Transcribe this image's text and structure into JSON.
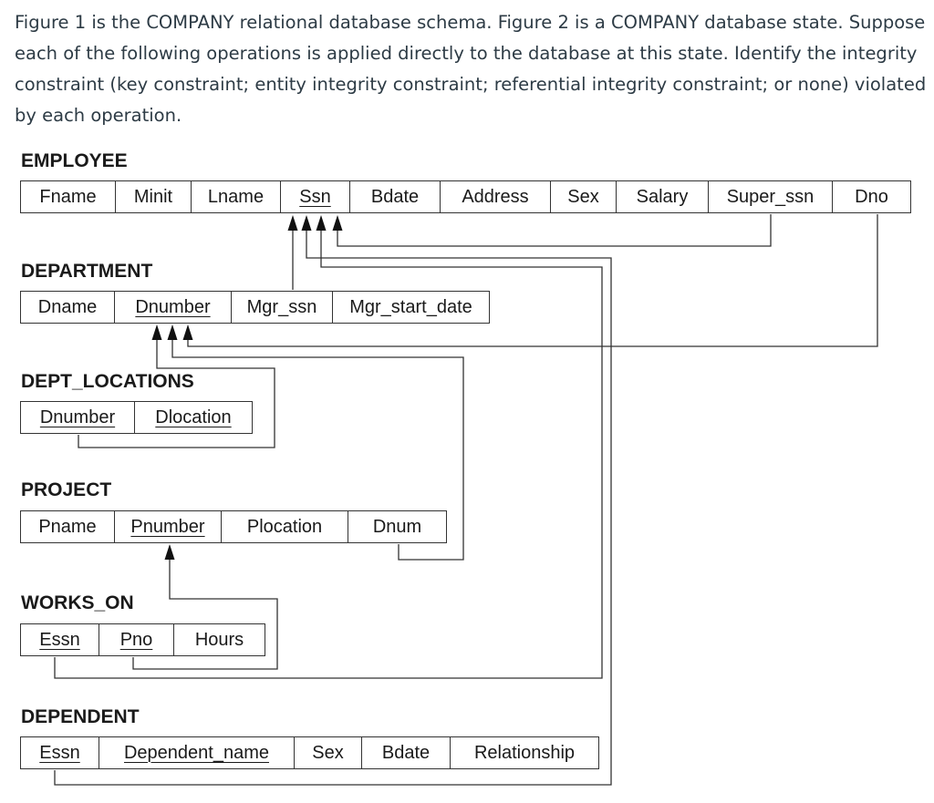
{
  "intro": "Figure 1 is the COMPANY relational database schema. Figure 2 is a COMPANY database state. Suppose each of the following operations is applied directly to the database at this state. Identify the integrity constraint (key constraint; entity integrity constraint; referential integrity constraint; or none) violated by each operation.",
  "tables": {
    "employee": {
      "name": "EMPLOYEE",
      "attrs": [
        "Fname",
        "Minit",
        "Lname",
        "Ssn",
        "Bdate",
        "Address",
        "Sex",
        "Salary",
        "Super_ssn",
        "Dno"
      ]
    },
    "department": {
      "name": "DEPARTMENT",
      "attrs": [
        "Dname",
        "Dnumber",
        "Mgr_ssn",
        "Mgr_start_date"
      ]
    },
    "dept_locations": {
      "name": "DEPT_LOCATIONS",
      "attrs": [
        "Dnumber",
        "Dlocation"
      ]
    },
    "project": {
      "name": "PROJECT",
      "attrs": [
        "Pname",
        "Pnumber",
        "Plocation",
        "Dnum"
      ]
    },
    "works_on": {
      "name": "WORKS_ON",
      "attrs": [
        "Essn",
        "Pno",
        "Hours"
      ]
    },
    "dependent": {
      "name": "DEPENDENT",
      "attrs": [
        "Essn",
        "Dependent_name",
        "Sex",
        "Bdate",
        "Relationship"
      ]
    }
  }
}
